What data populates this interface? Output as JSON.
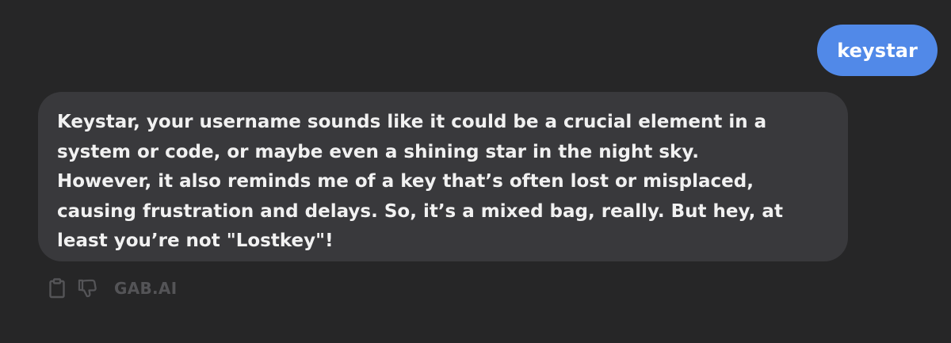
{
  "conversation": {
    "user_message": "keystar",
    "assistant_message": "Keystar, your username sounds like it could be a crucial element in a\nsystem or code, or maybe even a shining star in the night sky.\nHowever, it also reminds me of a key that’s often lost or misplaced,\ncausing frustration and delays. So, it’s a mixed bag, really. But hey, at\nleast you’re not \"Lostkey\"!"
  },
  "message_actions": {
    "icons": [
      "clipboard-icon",
      "thumbs-down-icon"
    ],
    "brand_label": "GAB.AI"
  },
  "colors": {
    "background": "#262627",
    "user_bubble": "#5189e8",
    "assistant_bubble": "#39393c",
    "assistant_text": "#f1f1f1",
    "muted": "#545457"
  }
}
